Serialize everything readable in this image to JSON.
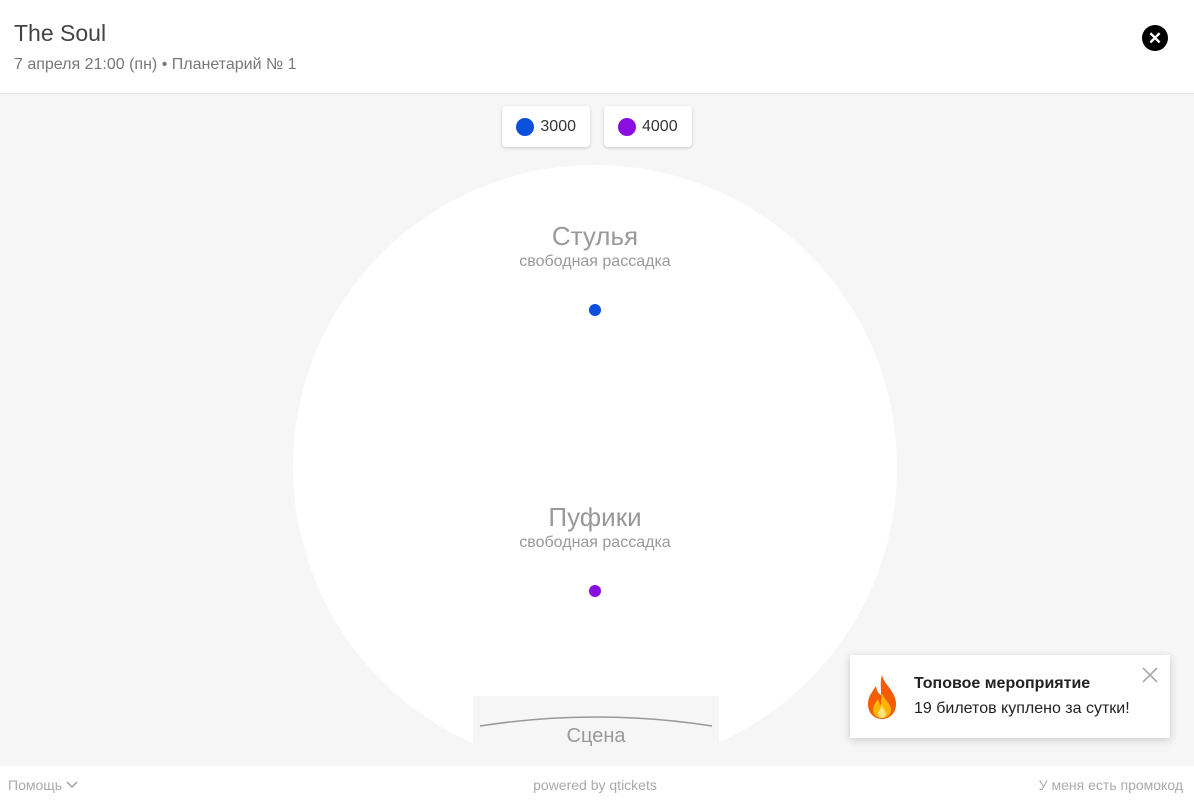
{
  "header": {
    "title": "The Soul",
    "subtitle": "7 апреля 21:00 (пн) • Планетарий № 1",
    "close_icon": "close-icon"
  },
  "legend": [
    {
      "price": "3000",
      "color": "#0b4fdd"
    },
    {
      "price": "4000",
      "color": "#8a0ee0"
    }
  ],
  "zones": [
    {
      "name": "Стулья",
      "note": "свободная рассадка",
      "color": "#0b4fdd"
    },
    {
      "name": "Пуфики",
      "note": "свободная рассадка",
      "color": "#8a0ee0"
    }
  ],
  "stage": {
    "label": "Сцена"
  },
  "toast": {
    "icon": "fire-icon",
    "title": "Топовое мероприятие",
    "text": "19 билетов куплено за сутки!"
  },
  "footer": {
    "help": "Помощь",
    "powered": "powered by qtickets",
    "promo": "У меня есть промокод"
  }
}
